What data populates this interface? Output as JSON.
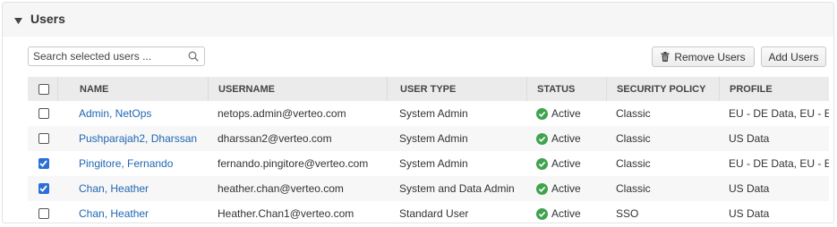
{
  "header": {
    "title": "Users"
  },
  "search": {
    "placeholder": "Search selected users ..."
  },
  "toolbar": {
    "remove_label": "Remove Users",
    "add_label": "Add Users"
  },
  "colors": {
    "link": "#1f66b3",
    "status_active": "#3fa34d",
    "checkbox_checked": "#2a6fd6",
    "header_bg": "#ebebeb"
  },
  "icons": {
    "toggle": "caret-down-icon",
    "search": "search-icon",
    "remove": "trash-icon",
    "status": "check-circle-icon"
  },
  "table": {
    "columns": [
      "NAME",
      "USERNAME",
      "USER TYPE",
      "STATUS",
      "SECURITY POLICY",
      "PROFILE"
    ],
    "rows": [
      {
        "checked": false,
        "name": "Admin, NetOps",
        "username": "netops.admin@verteo.com",
        "user_type": "System Admin",
        "status": "Active",
        "security_policy": "Classic",
        "profile": "EU - DE Data, EU - E"
      },
      {
        "checked": false,
        "name": "Pushparajah2, Dharssan",
        "username": "dharssan2@verteo.com",
        "user_type": "System Admin",
        "status": "Active",
        "security_policy": "Classic",
        "profile": "US Data"
      },
      {
        "checked": true,
        "name": "Pingitore, Fernando",
        "username": "fernando.pingitore@verteo.com",
        "user_type": "System Admin",
        "status": "Active",
        "security_policy": "Classic",
        "profile": "EU - DE Data, EU - E"
      },
      {
        "checked": true,
        "name": "Chan, Heather",
        "username": "heather.chan@verteo.com",
        "user_type": "System and Data Admin",
        "status": "Active",
        "security_policy": "Classic",
        "profile": "US Data"
      },
      {
        "checked": false,
        "name": "Chan, Heather",
        "username": "Heather.Chan1@verteo.com",
        "user_type": "Standard User",
        "status": "Active",
        "security_policy": "SSO",
        "profile": "US Data"
      }
    ]
  }
}
